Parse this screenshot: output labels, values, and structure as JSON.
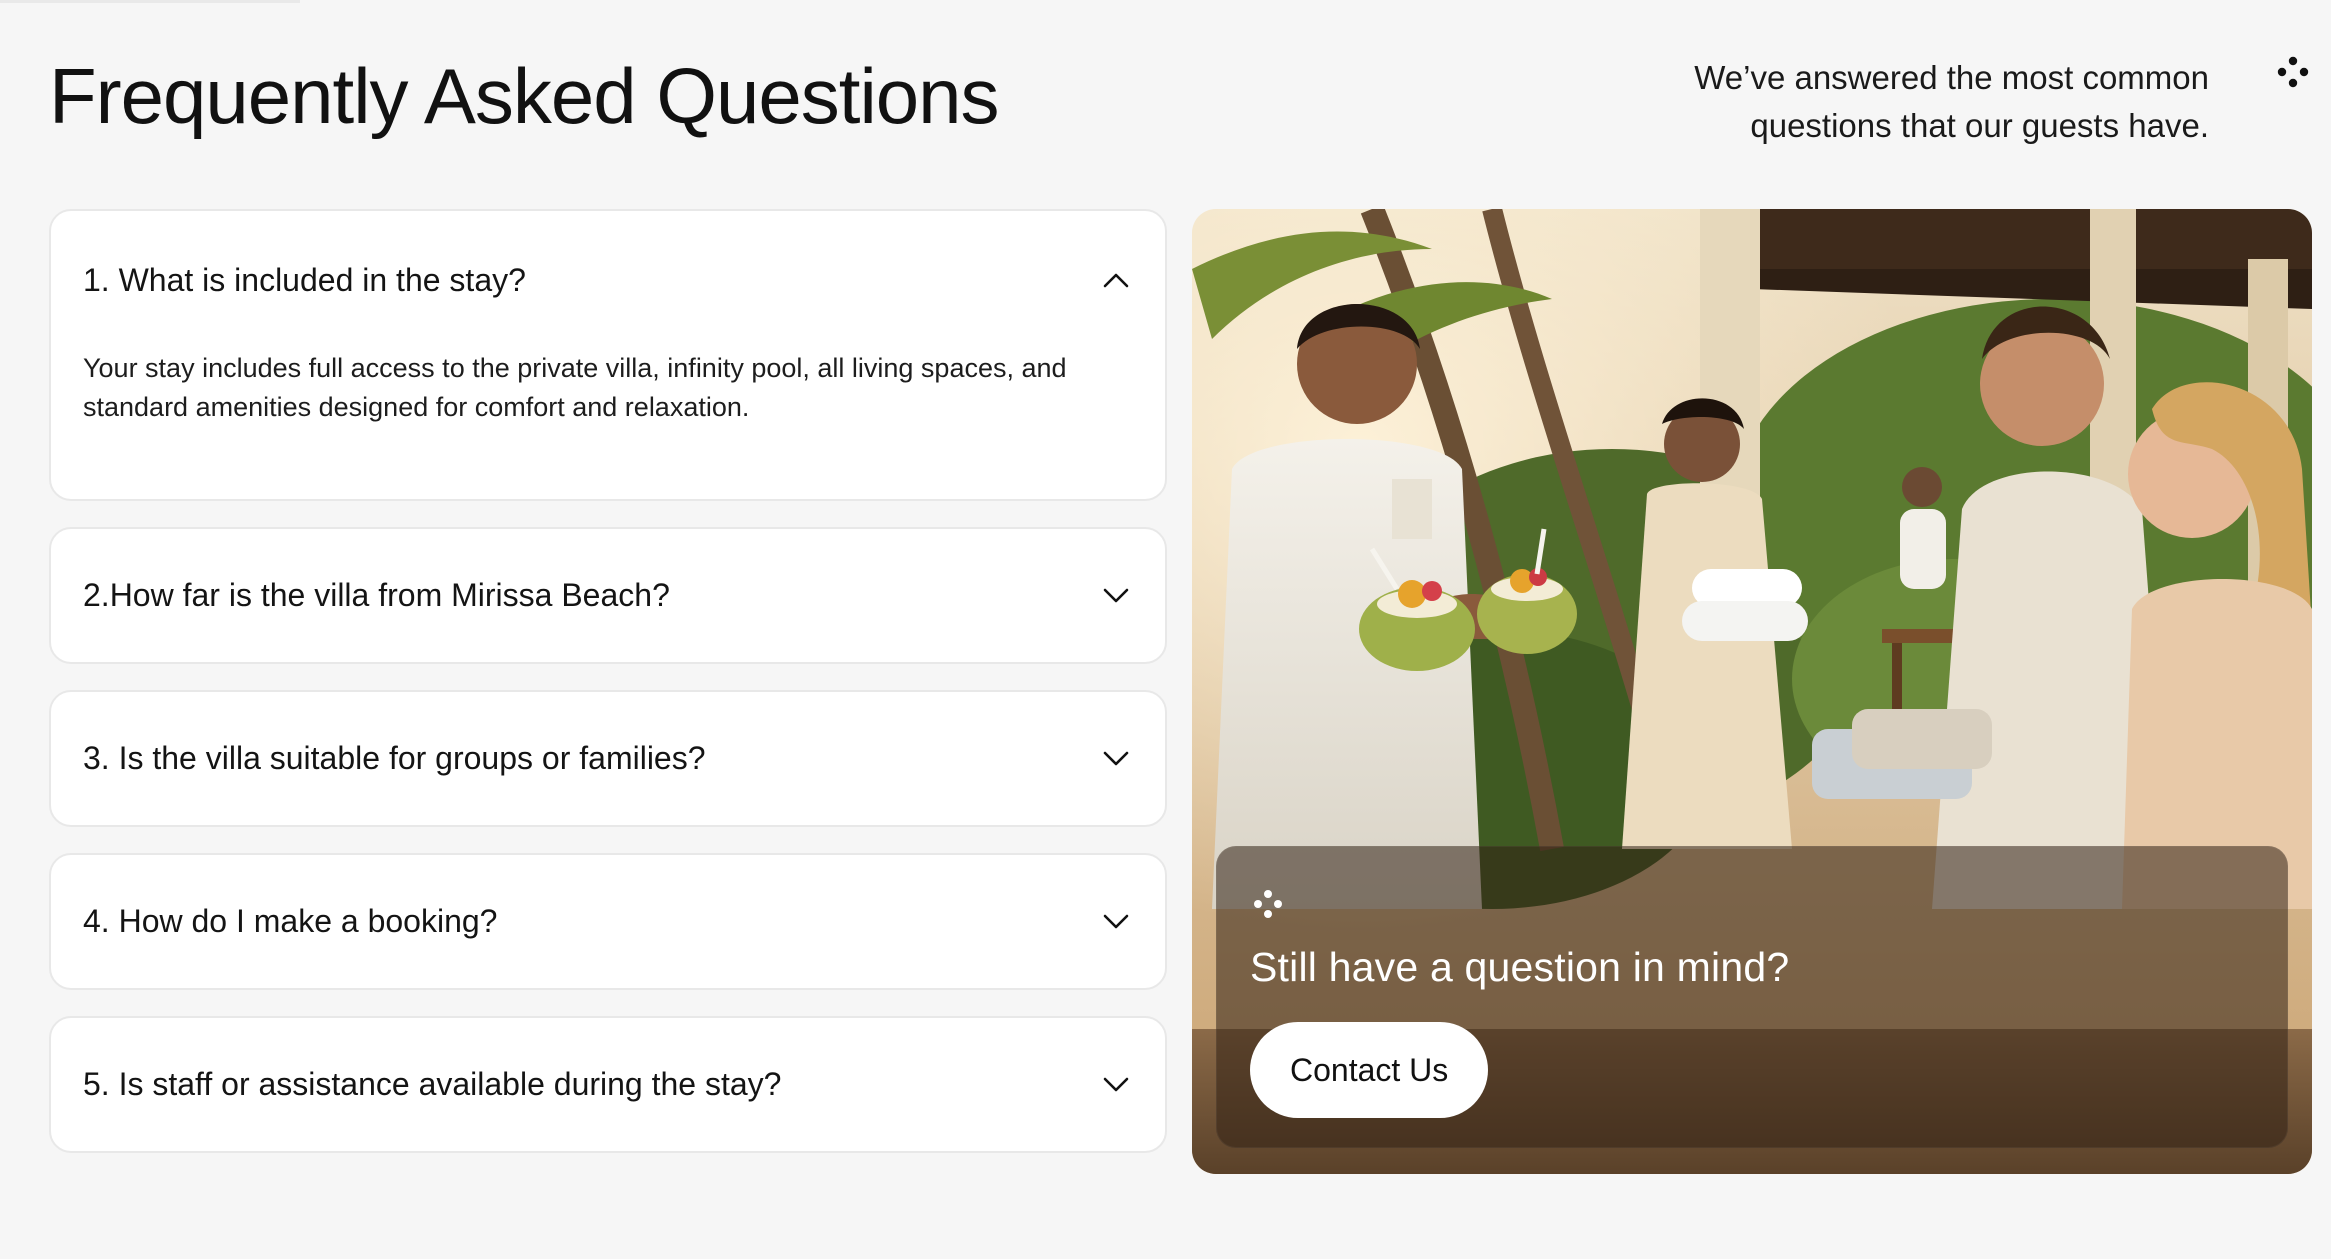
{
  "header": {
    "title": "Frequently Asked Questions",
    "intro_line1": "We’ve answered the most common",
    "intro_line2": "questions that our guests have.",
    "brand_icon": "four-dot-icon"
  },
  "faq": [
    {
      "question": "1. What is included in the stay?",
      "answer": "Your stay includes full access to the private villa, infinity pool, all living spaces, and standard amenities designed for comfort and relaxation.",
      "expanded": true
    },
    {
      "question": "2.How far is the villa from Mirissa Beach?",
      "expanded": false
    },
    {
      "question": "3. Is the villa suitable for groups or families?",
      "expanded": false
    },
    {
      "question": "4. How do I make a booking?",
      "expanded": false
    },
    {
      "question": "5. Is staff or assistance available during the stay?",
      "expanded": false
    }
  ],
  "cta": {
    "title": "Still have a question in mind?",
    "button_label": "Contact Us",
    "icon": "four-dot-icon"
  },
  "photo": {
    "subject": "villa-welcome-photo"
  }
}
